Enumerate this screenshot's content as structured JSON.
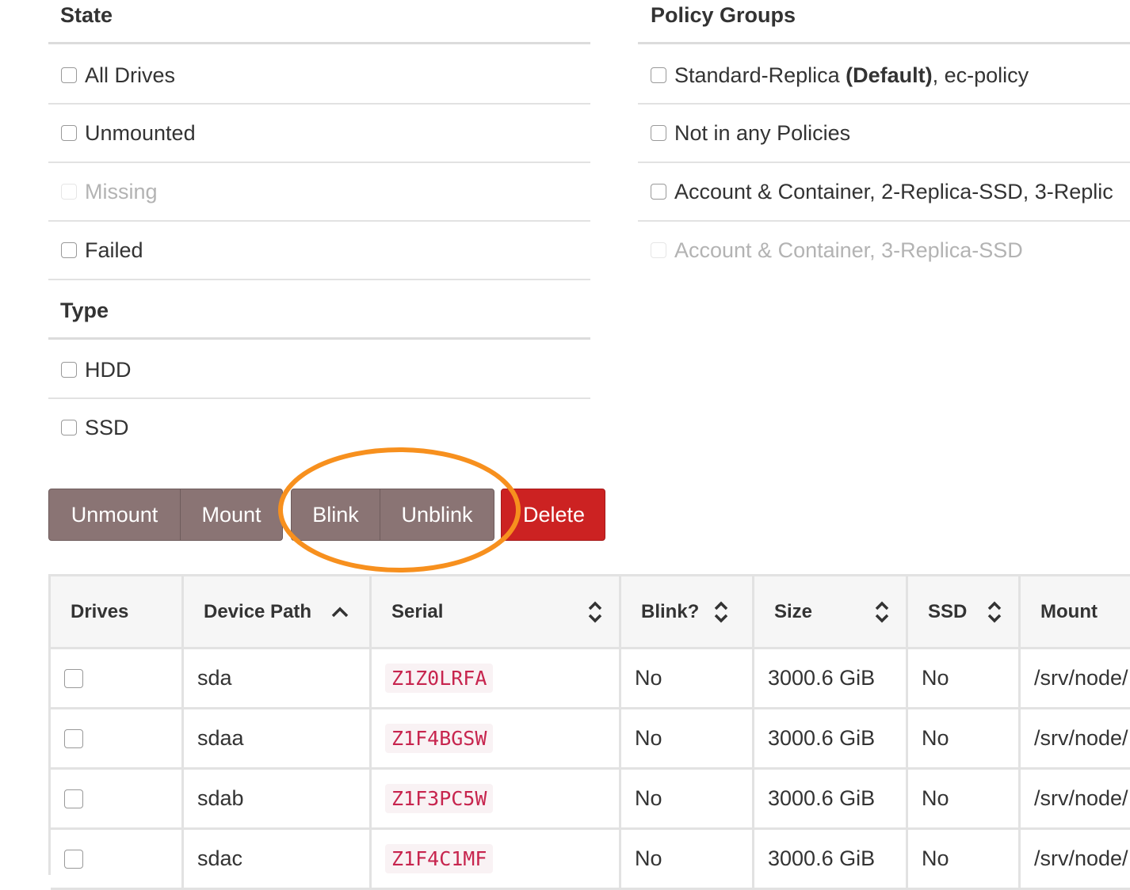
{
  "state": {
    "title": "State",
    "items": [
      {
        "label": "All Drives",
        "disabled": false
      },
      {
        "label": "Unmounted",
        "disabled": false
      },
      {
        "label": "Missing",
        "disabled": true
      },
      {
        "label": "Failed",
        "disabled": false
      }
    ]
  },
  "type": {
    "title": "Type",
    "items": [
      {
        "label": "HDD",
        "disabled": false
      },
      {
        "label": "SSD",
        "disabled": false
      }
    ]
  },
  "policy_groups": {
    "title": "Policy Groups",
    "items": [
      {
        "label_prefix": "Standard-Replica ",
        "label_bold": "(Default)",
        "label_suffix": ", ec-policy",
        "disabled": false
      },
      {
        "label": "Not in any Policies",
        "disabled": false
      },
      {
        "label": "Account & Container, 2-Replica-SSD, 3-Replic",
        "disabled": false
      },
      {
        "label": "Account & Container, 3-Replica-SSD",
        "disabled": true
      }
    ]
  },
  "actions": {
    "unmount": "Unmount",
    "mount": "Mount",
    "blink": "Blink",
    "unblink": "Unblink",
    "delete": "Delete"
  },
  "table": {
    "headers": [
      "Drives",
      "Device Path",
      "Serial",
      "Blink?",
      "Size",
      "SSD",
      "Mount"
    ],
    "rows": [
      {
        "device": "sda",
        "serial": "Z1Z0LRFA",
        "blink": "No",
        "size": "3000.6 GiB",
        "ssd": "No",
        "mount": "/srv/node/"
      },
      {
        "device": "sdaa",
        "serial": "Z1F4BGSW",
        "blink": "No",
        "size": "3000.6 GiB",
        "ssd": "No",
        "mount": "/srv/node/"
      },
      {
        "device": "sdab",
        "serial": "Z1F3PC5W",
        "blink": "No",
        "size": "3000.6 GiB",
        "ssd": "No",
        "mount": "/srv/node/"
      },
      {
        "device": "sdac",
        "serial": "Z1F4C1MF",
        "blink": "No",
        "size": "3000.6 GiB",
        "ssd": "No",
        "mount": "/srv/node/"
      }
    ]
  },
  "colors": {
    "highlight_ring": "#f7901e",
    "delete_button": "#cc2222",
    "grey_button": "#8a7474",
    "serial_text": "#c7254e"
  }
}
